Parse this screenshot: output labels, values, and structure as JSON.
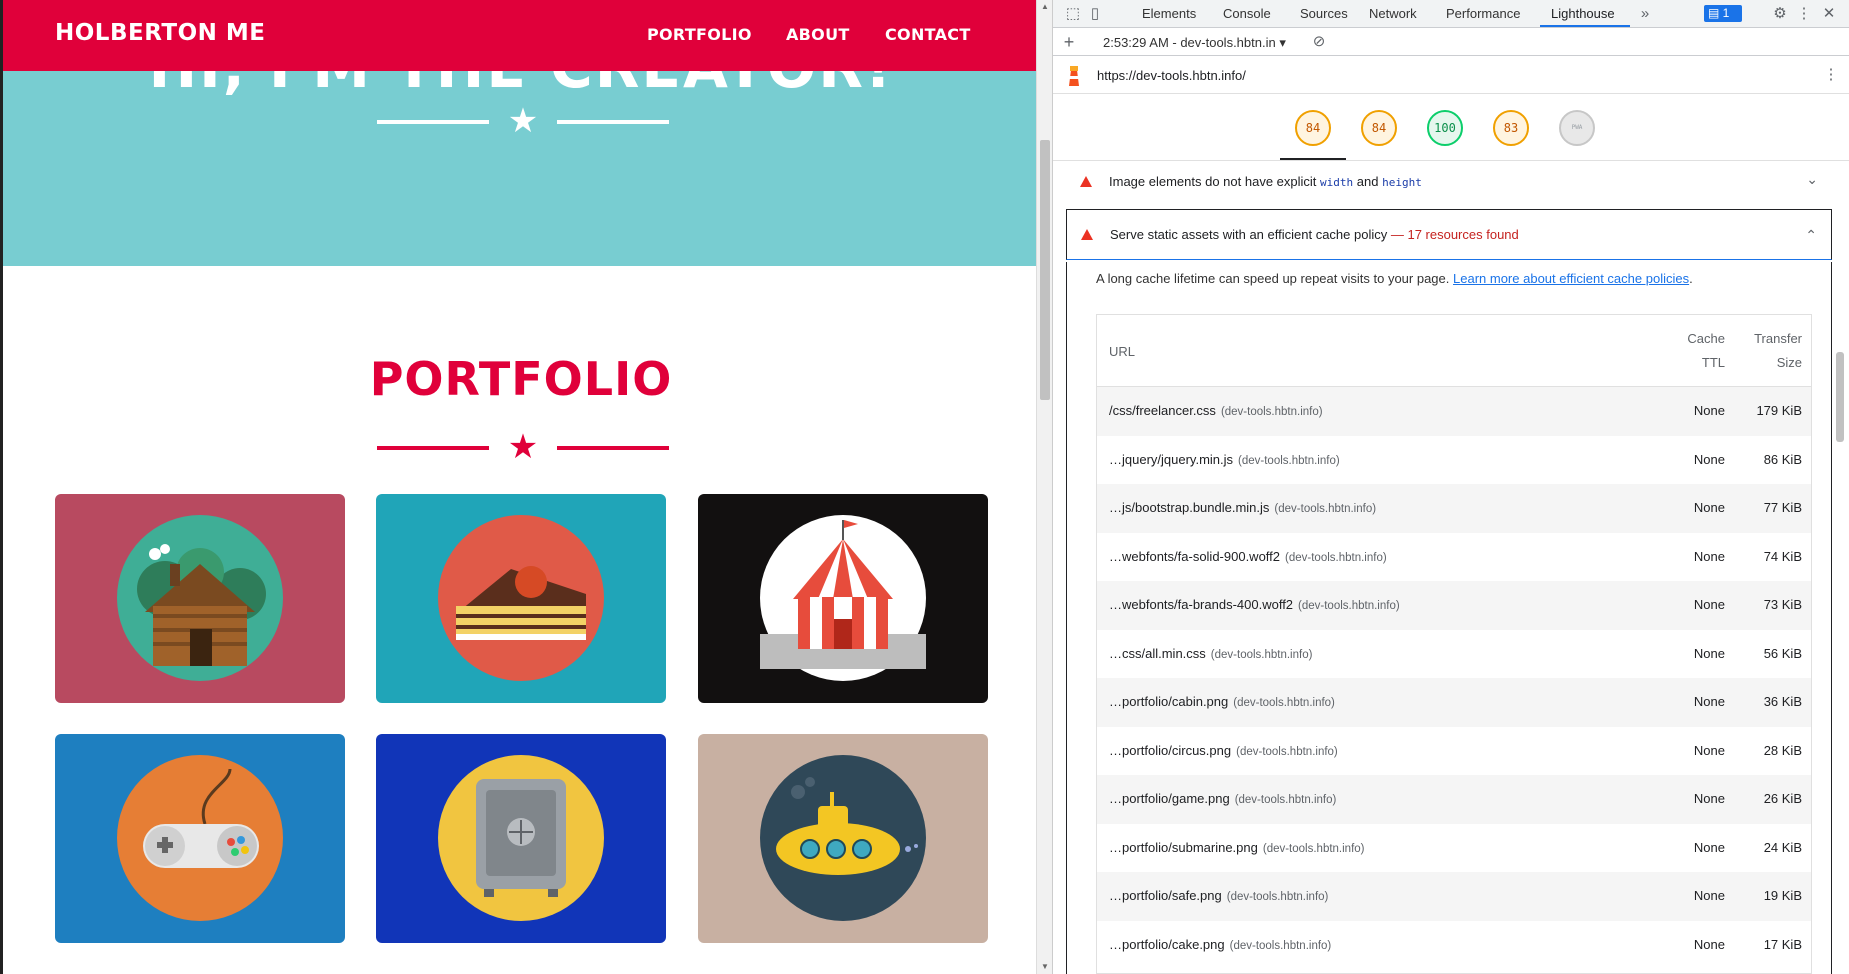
{
  "site": {
    "brand": "HOLBERTON ME",
    "nav": [
      "PORTFOLIO",
      "ABOUT",
      "CONTACT"
    ],
    "hero_text": "HI, I'M THE CREATOR!",
    "portfolio_title": "PORTFOLIO",
    "colors": {
      "accent": "#e0003a",
      "hero": "#78cdd1"
    },
    "tiles": [
      {
        "name": "cabin",
        "bg": "#b84a60",
        "icon": "cabin-icon"
      },
      {
        "name": "cake",
        "bg": "#20a5b8",
        "icon": "cake-icon"
      },
      {
        "name": "circus",
        "bg": "#121010",
        "icon": "circus-tent-icon"
      },
      {
        "name": "game",
        "bg": "#1e7fc0",
        "icon": "game-controller-icon"
      },
      {
        "name": "safe",
        "bg": "#1135b8",
        "icon": "safe-icon"
      },
      {
        "name": "submarine",
        "bg": "#c8b0a2",
        "icon": "submarine-icon"
      }
    ]
  },
  "devtools": {
    "tabs": [
      "Elements",
      "Console",
      "Sources",
      "Network",
      "Performance",
      "Lighthouse"
    ],
    "active_tab": "Lighthouse",
    "issues_count": "1",
    "report_label": "2:53:29 AM - dev-tools.hbtn.in",
    "url": "https://dev-tools.hbtn.info/",
    "scores": [
      {
        "value": "84",
        "color": "#f0a000"
      },
      {
        "value": "84",
        "color": "#f0a000"
      },
      {
        "value": "100",
        "color": "#0cce6b"
      },
      {
        "value": "83",
        "color": "#f0a000"
      },
      {
        "value": "PWA",
        "color": "#c7c7c7"
      }
    ],
    "audit1": {
      "text_before": "Image elements do not have explicit",
      "code1": "width",
      "and": "and",
      "code2": "height"
    },
    "audit2": {
      "title": "Serve static assets with an efficient cache policy",
      "found": "— 17 resources found",
      "description": "A long cache lifetime can speed up repeat visits to your page.",
      "link": "Learn more about efficient cache policies",
      "link_suffix": "."
    },
    "table": {
      "headers": {
        "url": "URL",
        "ttl_1": "Cache",
        "ttl_2": "TTL",
        "size_1": "Transfer",
        "size_2": "Size"
      },
      "rows": [
        {
          "url": "/css/freelancer.css",
          "host": "(dev-tools.hbtn.info)",
          "ttl": "None",
          "size": "179 KiB"
        },
        {
          "url": "…jquery/jquery.min.js",
          "host": "(dev-tools.hbtn.info)",
          "ttl": "None",
          "size": "86 KiB"
        },
        {
          "url": "…js/bootstrap.bundle.min.js",
          "host": "(dev-tools.hbtn.info)",
          "ttl": "None",
          "size": "77 KiB"
        },
        {
          "url": "…webfonts/fa-solid-900.woff2",
          "host": "(dev-tools.hbtn.info)",
          "ttl": "None",
          "size": "74 KiB"
        },
        {
          "url": "…webfonts/fa-brands-400.woff2",
          "host": "(dev-tools.hbtn.info)",
          "ttl": "None",
          "size": "73 KiB"
        },
        {
          "url": "…css/all.min.css",
          "host": "(dev-tools.hbtn.info)",
          "ttl": "None",
          "size": "56 KiB"
        },
        {
          "url": "…portfolio/cabin.png",
          "host": "(dev-tools.hbtn.info)",
          "ttl": "None",
          "size": "36 KiB"
        },
        {
          "url": "…portfolio/circus.png",
          "host": "(dev-tools.hbtn.info)",
          "ttl": "None",
          "size": "28 KiB"
        },
        {
          "url": "…portfolio/game.png",
          "host": "(dev-tools.hbtn.info)",
          "ttl": "None",
          "size": "26 KiB"
        },
        {
          "url": "…portfolio/submarine.png",
          "host": "(dev-tools.hbtn.info)",
          "ttl": "None",
          "size": "24 KiB"
        },
        {
          "url": "…portfolio/safe.png",
          "host": "(dev-tools.hbtn.info)",
          "ttl": "None",
          "size": "19 KiB"
        },
        {
          "url": "…portfolio/cake.png",
          "host": "(dev-tools.hbtn.info)",
          "ttl": "None",
          "size": "17 KiB"
        }
      ]
    }
  }
}
